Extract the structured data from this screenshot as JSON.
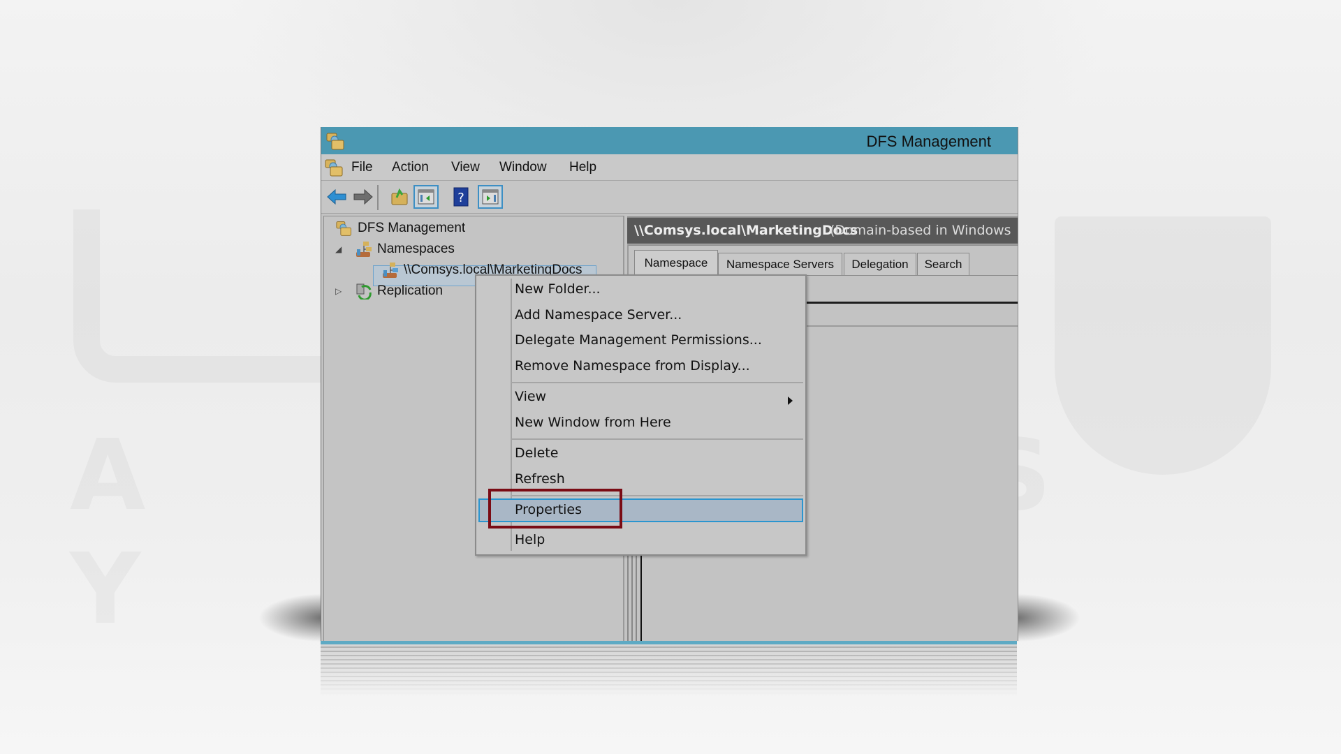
{
  "window": {
    "title": "DFS Management",
    "titlebar_color": "#4b98b2"
  },
  "menubar": {
    "items": [
      "File",
      "Action",
      "View",
      "Window",
      "Help"
    ]
  },
  "toolbar": {
    "buttons": [
      {
        "icon": "back-arrow-icon"
      },
      {
        "icon": "forward-arrow-icon"
      },
      {
        "icon": "up-one-level-icon"
      },
      {
        "icon": "show-hide-console-tree-icon"
      },
      {
        "icon": "help-icon"
      },
      {
        "icon": "show-hide-action-pane-icon"
      }
    ]
  },
  "tree": {
    "root": "DFS Management",
    "namespaces": "Namespaces",
    "namespace_item": "\\\\Comsys.local\\MarketingDocs",
    "replication": "Replication"
  },
  "right_pane": {
    "header_path": "\\\\Comsys.local\\MarketingDocs",
    "header_type": "(Domain-based in Windows",
    "tabs": [
      "Namespace",
      "Namespace Servers",
      "Delegation",
      "Search"
    ],
    "active_tab": "Namespace"
  },
  "context_menu": {
    "items": [
      "New Folder...",
      "Add Namespace Server...",
      "Delegate Management Permissions...",
      "Remove Namespace from Display...",
      "View",
      "New Window from Here",
      "Delete",
      "Refresh",
      "Properties",
      "Help"
    ],
    "highlighted": "Properties",
    "submenu_item": "View",
    "highlight_color": "#2a95cf",
    "callout_color": "#7a0b14"
  },
  "watermark": {
    "letters": "A Z A S Y S"
  }
}
